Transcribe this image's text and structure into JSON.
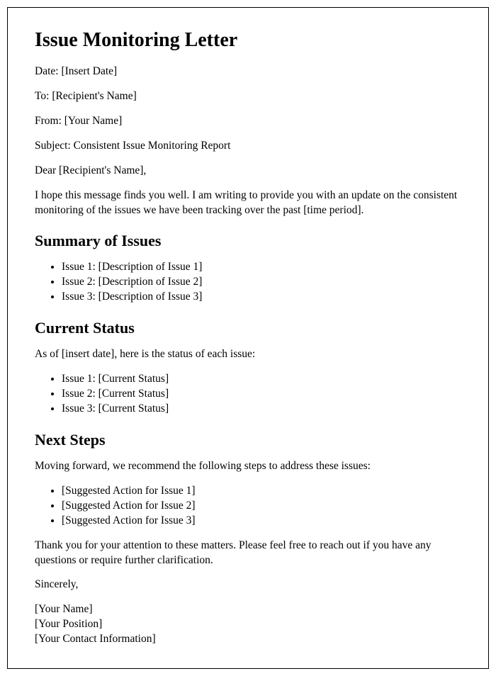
{
  "title": "Issue Monitoring Letter",
  "date_line": "Date: [Insert Date]",
  "to_line": "To: [Recipient's Name]",
  "from_line": "From: [Your Name]",
  "subject_line": "Subject: Consistent Issue Monitoring Report",
  "salutation": "Dear [Recipient's Name],",
  "intro": "I hope this message finds you well. I am writing to provide you with an update on the consistent monitoring of the issues we have been tracking over the past [time period].",
  "summary_heading": "Summary of Issues",
  "summary_items": [
    "Issue 1: [Description of Issue 1]",
    "Issue 2: [Description of Issue 2]",
    "Issue 3: [Description of Issue 3]"
  ],
  "status_heading": "Current Status",
  "status_intro": "As of [insert date], here is the status of each issue:",
  "status_items": [
    "Issue 1: [Current Status]",
    "Issue 2: [Current Status]",
    "Issue 3: [Current Status]"
  ],
  "next_heading": "Next Steps",
  "next_intro": "Moving forward, we recommend the following steps to address these issues:",
  "next_items": [
    "[Suggested Action for Issue 1]",
    "[Suggested Action for Issue 2]",
    "[Suggested Action for Issue 3]"
  ],
  "thanks": "Thank you for your attention to these matters. Please feel free to reach out if you have any questions or require further clarification.",
  "closing": "Sincerely,",
  "sig_name": "[Your Name]",
  "sig_position": "[Your Position]",
  "sig_contact": "[Your Contact Information]"
}
